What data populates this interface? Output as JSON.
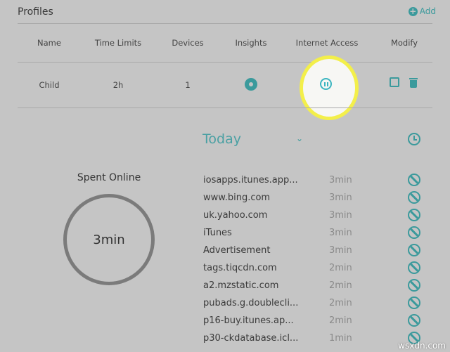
{
  "header": {
    "title": "Profiles",
    "add_label": "Add"
  },
  "table": {
    "columns": [
      "Name",
      "Time Limits",
      "Devices",
      "Insights",
      "Internet Access",
      "Modify"
    ],
    "rows": [
      {
        "name": "Child",
        "time_limits": "2h",
        "devices": "1",
        "internet_access": "active (pause button)"
      }
    ]
  },
  "insights": {
    "period": "Today",
    "spent_label": "Spent Online",
    "spent_value": "3min",
    "sites": [
      {
        "name": "iosapps.itunes.app...",
        "time": "3min"
      },
      {
        "name": "www.bing.com",
        "time": "3min"
      },
      {
        "name": "uk.yahoo.com",
        "time": "3min"
      },
      {
        "name": "iTunes",
        "time": "3min"
      },
      {
        "name": "Advertisement",
        "time": "3min"
      },
      {
        "name": "tags.tiqcdn.com",
        "time": "2min"
      },
      {
        "name": "a2.mzstatic.com",
        "time": "2min"
      },
      {
        "name": "pubads.g.doublecli...",
        "time": "2min"
      },
      {
        "name": "p16-buy.itunes.ap...",
        "time": "2min"
      },
      {
        "name": "p30-ckdatabase.icl...",
        "time": "1min"
      }
    ]
  },
  "watermark": "wsxdn.com",
  "colors": {
    "accent": "#3b9a9c",
    "highlight": "#f3ef4a",
    "background": "#c5c5c5"
  }
}
